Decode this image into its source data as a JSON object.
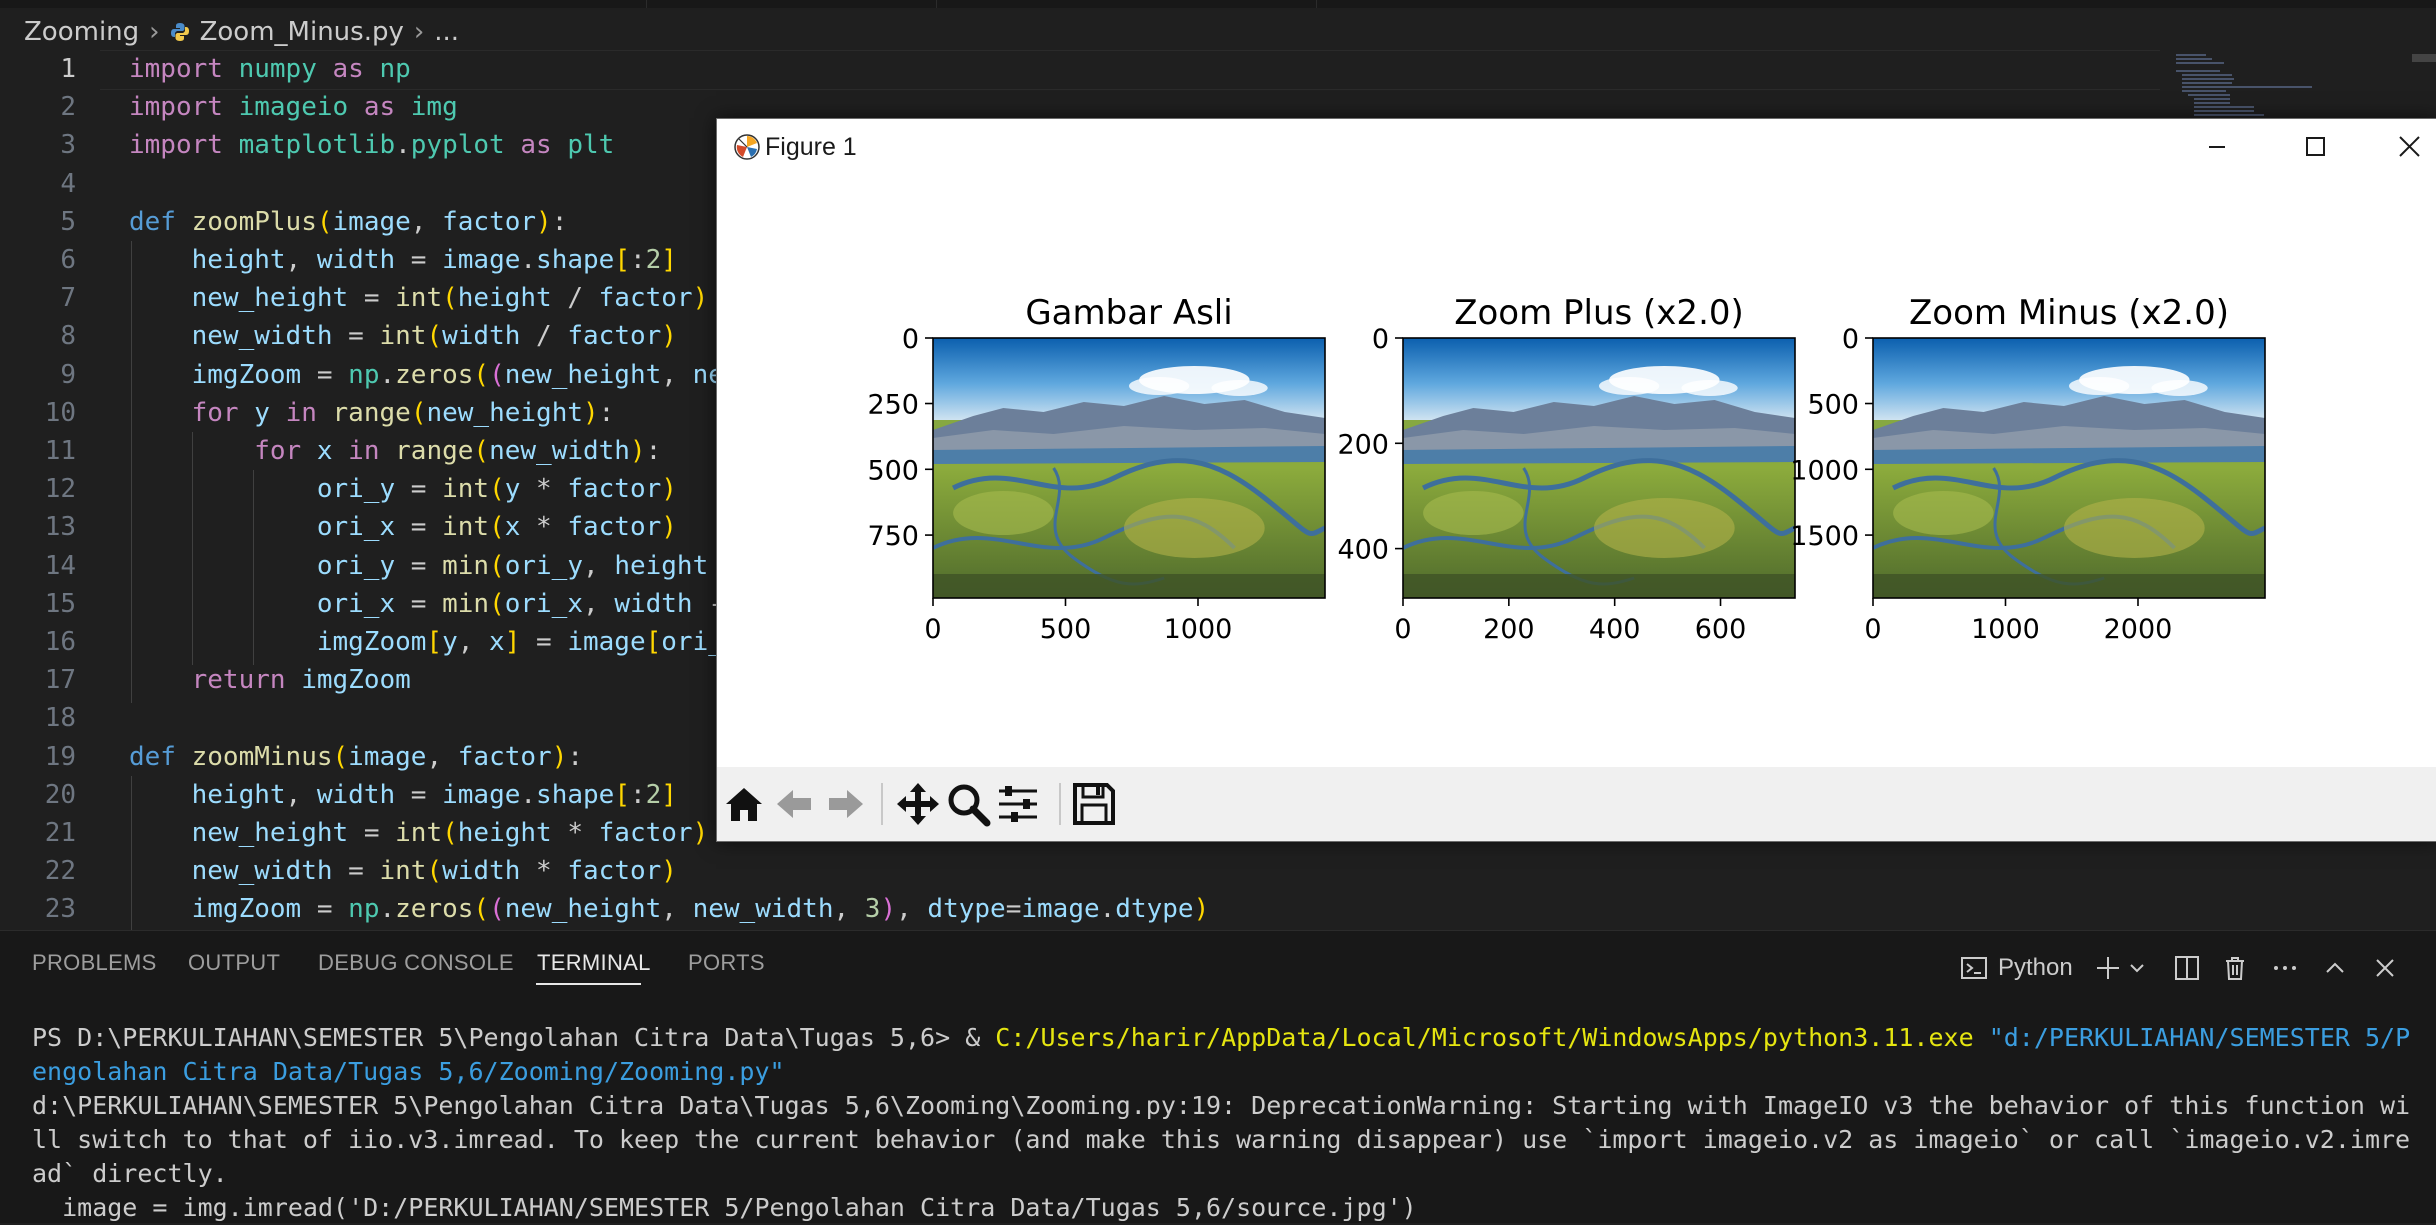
{
  "breadcrumb": {
    "folder": "Zooming",
    "file": "Zoom_Minus.py",
    "more": "..."
  },
  "code_lines": [
    {
      "n": "1",
      "t": "import numpy as np"
    },
    {
      "n": "2",
      "t": "import imageio as img"
    },
    {
      "n": "3",
      "t": "import matplotlib.pyplot as plt"
    },
    {
      "n": "4",
      "t": ""
    },
    {
      "n": "5",
      "t": "def zoomPlus(image, factor):"
    },
    {
      "n": "6",
      "t": "    height, width = image.shape[:2]"
    },
    {
      "n": "7",
      "t": "    new_height = int(height / factor)"
    },
    {
      "n": "8",
      "t": "    new_width = int(width / factor)"
    },
    {
      "n": "9",
      "t": "    imgZoom = np.zeros((new_height, ne"
    },
    {
      "n": "10",
      "t": "    for y in range(new_height):"
    },
    {
      "n": "11",
      "t": "        for x in range(new_width):"
    },
    {
      "n": "12",
      "t": "            ori_y = int(y * factor)"
    },
    {
      "n": "13",
      "t": "            ori_x = int(x * factor)"
    },
    {
      "n": "14",
      "t": "            ori_y = min(ori_y, height"
    },
    {
      "n": "15",
      "t": "            ori_x = min(ori_x, width -"
    },
    {
      "n": "16",
      "t": "            imgZoom[y, x] = image[ori_"
    },
    {
      "n": "17",
      "t": "    return imgZoom"
    },
    {
      "n": "18",
      "t": ""
    },
    {
      "n": "19",
      "t": "def zoomMinus(image, factor):"
    },
    {
      "n": "20",
      "t": "    height, width = image.shape[:2]"
    },
    {
      "n": "21",
      "t": "    new_height = int(height * factor)"
    },
    {
      "n": "22",
      "t": "    new_width = int(width * factor)"
    },
    {
      "n": "23",
      "t": "    imgZoom = np.zeros((new_height, new_width, 3), dtype=image.dtype)"
    }
  ],
  "figure": {
    "title": "Figure 1",
    "subplots": [
      {
        "title": "Gambar Asli",
        "yticks": [
          "0",
          "250",
          "500",
          "750"
        ],
        "xticks": [
          "0",
          "500",
          "1000"
        ]
      },
      {
        "title": "Zoom Plus (x2.0)",
        "yticks": [
          "0",
          "200",
          "400"
        ],
        "xticks": [
          "0",
          "200",
          "400",
          "600"
        ]
      },
      {
        "title": "Zoom Minus (x2.0)",
        "yticks": [
          "0",
          "500",
          "1000",
          "1500"
        ],
        "xticks": [
          "0",
          "1000",
          "2000"
        ]
      }
    ],
    "toolbar_icons": [
      "home-icon",
      "back-arrow-icon",
      "forward-arrow-icon",
      "pan-icon",
      "zoom-icon",
      "configure-subplots-icon",
      "save-icon"
    ]
  },
  "panel": {
    "tabs": [
      "PROBLEMS",
      "OUTPUT",
      "DEBUG CONSOLE",
      "TERMINAL",
      "PORTS"
    ],
    "active_tab": "TERMINAL",
    "terminal_profile": "Python",
    "terminal": {
      "prompt": "PS D:\\PERKULIAHAN\\SEMESTER 5\\Pengolahan Citra Data\\Tugas 5,6> ",
      "amp": "& ",
      "cmd": "C:/Users/harir/AppData/Local/Microsoft/WindowsApps/python3.11.exe",
      "arg1": " \"d:/PERKULIAHAN/SEMESTER 5/P",
      "arg2": "engolahan Citra Data/Tugas 5,6/Zooming/Zooming.py\"",
      "warn1": "d:\\PERKULIAHAN\\SEMESTER 5\\Pengolahan Citra Data\\Tugas 5,6\\Zooming\\Zooming.py:19: DeprecationWarning: Starting with ImageIO v3 the behavior of this function wi",
      "warn2": "ll switch to that of iio.v3.imread. To keep the current behavior (and make this warning disappear) use `import imageio.v2 as imageio` or call `imageio.v2.imre",
      "warn3": "ad` directly.",
      "warn4": "  image = img.imread('D:/PERKULIAHAN/SEMESTER 5/Pengolahan Citra Data/Tugas 5,6/source.jpg')"
    }
  }
}
